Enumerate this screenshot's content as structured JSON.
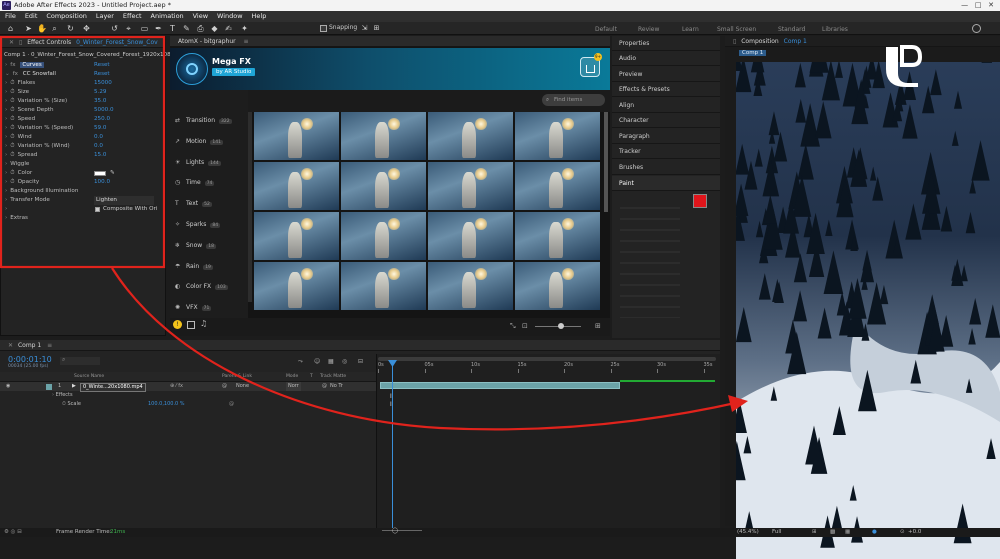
{
  "app": {
    "name": "Adobe After Effects 2023",
    "title": "Adobe After Effects 2023 - Untitled Project.aep *",
    "logo": "Ae"
  },
  "menu": [
    "File",
    "Edit",
    "Composition",
    "Layer",
    "Effect",
    "Animation",
    "View",
    "Window",
    "Help"
  ],
  "toolbar": {
    "snapping": "Snapping"
  },
  "workspaces": [
    "Default",
    "Review",
    "Learn",
    "Small Screen",
    "Standard",
    "Libraries"
  ],
  "effect_controls": {
    "tab": "Effect Controls",
    "tab_layer": "0_Winter_Forest_Snow_Cov",
    "path": "Comp 1 · 0_Winter_Forest_Snow_Covered_Forest_1920x108",
    "curves": {
      "label": "Curves",
      "reset": "Reset"
    },
    "cc": {
      "label": "CC Snowfall",
      "reset": "Reset"
    },
    "props": [
      {
        "name": "Flakes",
        "value": "15000"
      },
      {
        "name": "Size",
        "value": "5.29"
      },
      {
        "name": "Variation % (Size)",
        "value": "35.0"
      },
      {
        "name": "Scene Depth",
        "value": "5000.0"
      },
      {
        "name": "Speed",
        "value": "250.0"
      },
      {
        "name": "Variation % (Speed)",
        "value": "59.0"
      },
      {
        "name": "Wind",
        "value": "0.0"
      },
      {
        "name": "Variation % (Wind)",
        "value": "0.0"
      },
      {
        "name": "Spread",
        "value": "15.0"
      },
      {
        "name": "Wiggle",
        "value": ""
      },
      {
        "name": "Color",
        "value": ""
      },
      {
        "name": "Opacity",
        "value": "100.0"
      },
      {
        "name": "Background Illumination",
        "value": ""
      },
      {
        "name": "Transfer Mode",
        "value": "Lighten"
      },
      {
        "name": "",
        "value": "Composite With Ori"
      },
      {
        "name": "Extras",
        "value": ""
      }
    ]
  },
  "atomx": {
    "tab": "AtomX - bitgraphur",
    "title": "Mega FX",
    "subtitle": "by AR Studio",
    "search_placeholder": "Find items",
    "cart_badge": "9+",
    "categories": [
      {
        "name": "Transition",
        "count": "322"
      },
      {
        "name": "Motion",
        "count": "141"
      },
      {
        "name": "Lights",
        "count": "144"
      },
      {
        "name": "Time",
        "count": "74"
      },
      {
        "name": "Text",
        "count": "52"
      },
      {
        "name": "Sparks",
        "count": "84"
      },
      {
        "name": "Snow",
        "count": "18"
      },
      {
        "name": "Rain",
        "count": "19"
      },
      {
        "name": "Color FX",
        "count": "103"
      },
      {
        "name": "VFX",
        "count": "71"
      }
    ]
  },
  "right_panels": {
    "items": [
      "Properties",
      "Audio",
      "Preview",
      "Effects & Presets",
      "Align",
      "Character",
      "Paragraph",
      "Tracker",
      "Brushes",
      "Paint"
    ]
  },
  "composition": {
    "tab": "Composition",
    "comp_name": "Comp 1",
    "breadcrumb": "Comp 1",
    "zoom": "(45.4%)",
    "resolution": "Full",
    "exposure": "+0.0"
  },
  "timeline": {
    "comp": "Comp 1",
    "timecode": "0:00:01:10",
    "frame_info": "00034 (25.00 fps)",
    "columns": {
      "source": "Source Name",
      "parent": "Parent & Link",
      "mode": "Mode",
      "t": "T",
      "track": "Track Matte"
    },
    "layer": {
      "index": "1",
      "name": "0_Winte...20x1080.mp4",
      "mode": "Norr",
      "parent": "None",
      "track": "No Tr"
    },
    "effects": "Effects",
    "scale_label": "Scale",
    "scale_value": "100.0,100.0 %",
    "ruler": [
      "0s",
      "05s",
      "10s",
      "15s",
      "20s",
      "25s",
      "30s",
      "35s"
    ]
  },
  "status": {
    "render_label": "Frame Render Time:",
    "render_value": "21ms"
  },
  "colors": {
    "accent": "#3a8fd9",
    "annotation": "#e0231c",
    "paint_red": "#e0151b",
    "work_area": "#6ba3a8"
  }
}
